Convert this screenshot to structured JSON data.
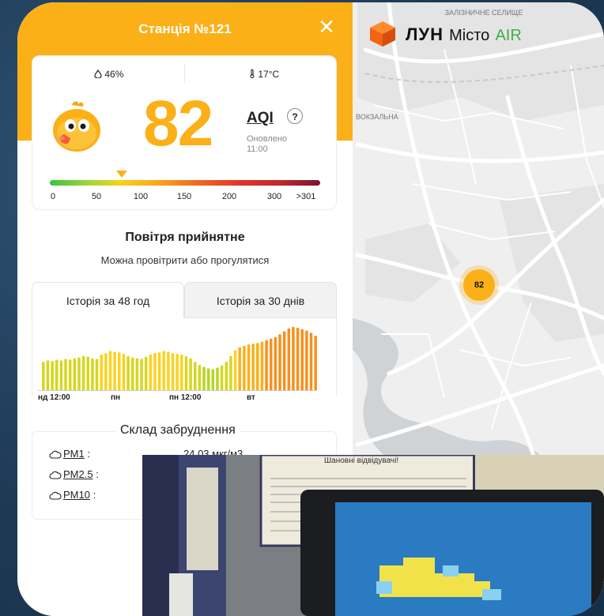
{
  "panel": {
    "title": "Станція №121",
    "close_label": "✕",
    "humidity": "46%",
    "temperature": "17°C",
    "aqi_value": "82",
    "aqi_label": "AQI",
    "help_label": "?",
    "updated_label": "Оновлено",
    "updated_time": "11:00",
    "scale_marker_value": 82,
    "scale_ticks": [
      "0",
      "50",
      "100",
      "150",
      "200",
      "300",
      ">301"
    ],
    "quality_title": "Повітря прийнятне",
    "quality_advice": "Можна провітрити або прогулятися",
    "tabs": [
      "Історія за 48 год",
      "Історія за 30 днів"
    ],
    "history_labels": [
      "нд 12:00",
      "пн",
      "пн 12:00",
      "вт"
    ],
    "history_values": [
      40,
      42,
      41,
      43,
      42,
      44,
      43,
      45,
      46,
      48,
      47,
      45,
      44,
      50,
      52,
      55,
      54,
      53,
      51,
      48,
      46,
      45,
      44,
      47,
      50,
      52,
      53,
      55,
      54,
      52,
      51,
      50,
      48,
      45,
      40,
      36,
      33,
      31,
      30,
      32,
      35,
      40,
      48,
      56,
      60,
      62,
      64,
      65,
      66,
      68,
      70,
      72,
      74,
      78,
      82,
      86,
      88,
      87,
      85,
      83,
      80,
      76
    ],
    "composition_title": "Склад забруднення",
    "pollutants": [
      {
        "name": "PM1",
        "suffix": " :",
        "value": "24.03 мкг/м3"
      },
      {
        "name": "PM2.5",
        "suffix": " :",
        "value": ""
      },
      {
        "name": "PM10",
        "suffix": " :",
        "value": ""
      }
    ],
    "colors": {
      "accent": "#fbb018",
      "good": "#3cc040",
      "bad": "#7a1430"
    }
  },
  "brand": {
    "name": "ЛУН",
    "sub": "Місто",
    "air": "AIR"
  },
  "map": {
    "labels": [
      "ЗАЛІЗНИЧНЕ СЕЛИЩЕ",
      "ВОКЗАЛЬНА"
    ],
    "station_marker": "82"
  },
  "photo": {
    "notice_title": "Шановні відвідувачі!"
  }
}
